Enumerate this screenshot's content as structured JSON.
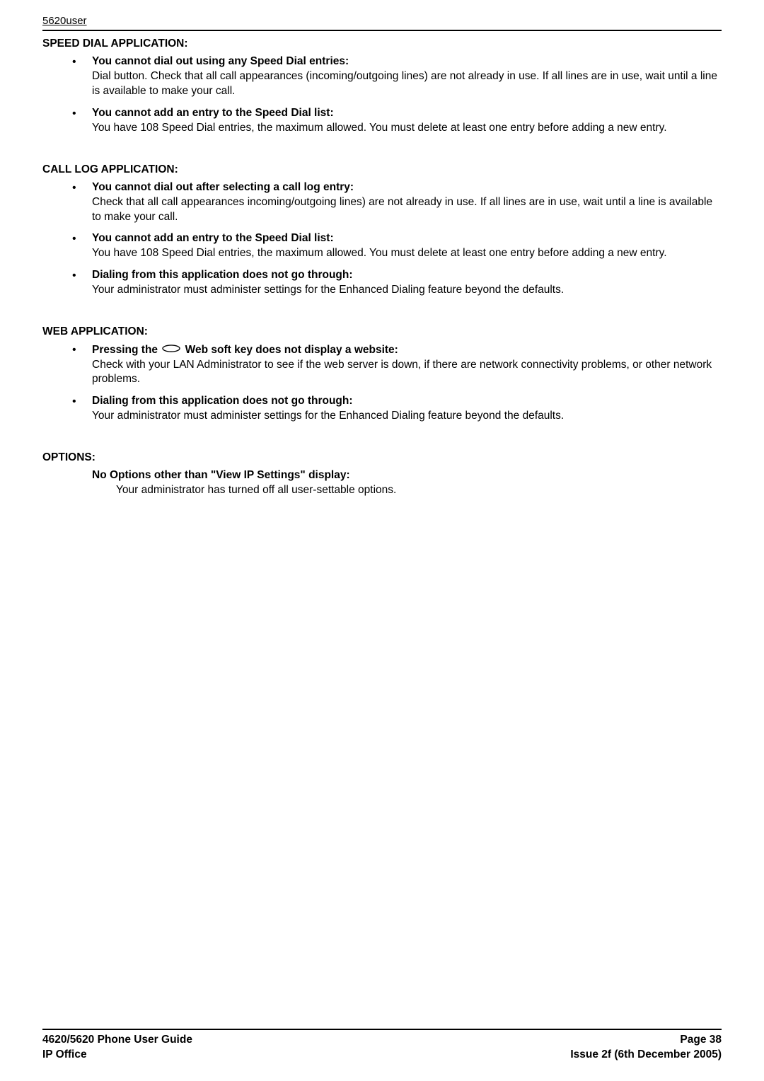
{
  "header": {
    "label": "5620user"
  },
  "sections": {
    "speed_dial": {
      "title": "SPEED DIAL APPLICATION:",
      "items": [
        {
          "head": "You cannot dial out using any Speed Dial entries:",
          "body": "Dial button. Check that all call appearances (incoming/outgoing lines) are not already in use. If all lines are in use, wait until a line is available to make your call."
        },
        {
          "head": "You cannot add an entry to the Speed Dial list:",
          "body": "You have 108 Speed Dial entries, the maximum allowed. You must delete at least one entry before adding a new entry."
        }
      ]
    },
    "call_log": {
      "title": "CALL LOG APPLICATION:",
      "items": [
        {
          "head": "You cannot dial out after selecting a call log entry:",
          "body": "Check that all call appearances incoming/outgoing lines) are not already in use. If all lines are in use, wait until a line is available to make your call."
        },
        {
          "head": "You cannot add an entry to the Speed Dial list:",
          "body": "You have 108 Speed Dial entries, the maximum allowed. You must delete at least one entry before adding a new entry."
        },
        {
          "head": "Dialing from this application does not go through:",
          "body": "Your administrator must administer settings for the Enhanced Dialing feature beyond the defaults."
        }
      ]
    },
    "web_app": {
      "title": "WEB APPLICATION:",
      "items": [
        {
          "head_pre": "Pressing the ",
          "head_post": " Web soft key does not display a website:",
          "body": "Check with your LAN Administrator to see if the web server is down, if there are network connectivity problems, or other network problems."
        },
        {
          "head": "Dialing from this application does not go through:",
          "body": "Your administrator must administer settings for the Enhanced Dialing feature beyond the defaults."
        }
      ]
    },
    "options": {
      "title": "OPTIONS:",
      "head": "No Options other than \"View IP Settings\" display:",
      "body": "Your administrator has turned off all user-settable options."
    }
  },
  "footer": {
    "left1": "4620/5620 Phone User Guide",
    "right1": "Page 38",
    "left2": "IP Office",
    "right2": "Issue 2f (6th December 2005)"
  }
}
